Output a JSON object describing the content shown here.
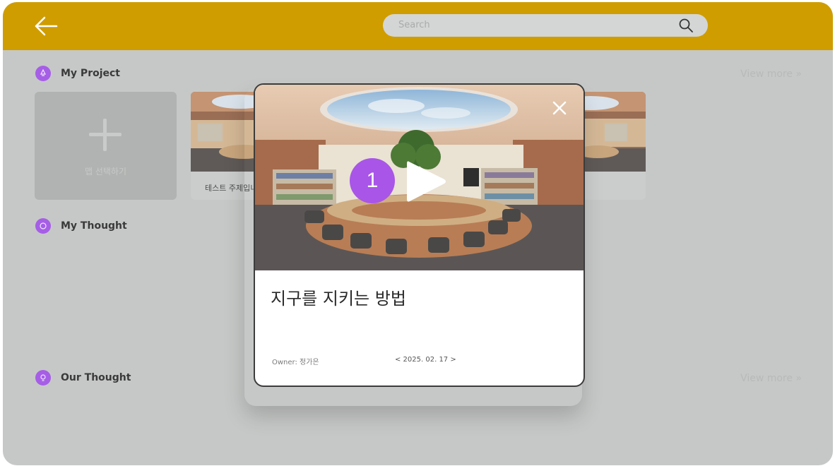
{
  "header": {
    "search_placeholder": "Search",
    "back_icon": "arrow-left-icon",
    "search_icon": "search-icon"
  },
  "sections": {
    "my_project": {
      "title": "My Project",
      "view_more": "View more »",
      "icon": "rocket-icon"
    },
    "my_thought": {
      "title": "My Thought",
      "icon": "brain-icon"
    },
    "our_thought": {
      "title": "Our Thought",
      "view_more": "View more »",
      "icon": "lightbulb-icon"
    }
  },
  "add_card": {
    "label": "맵 선택하기",
    "icon": "plus-icon"
  },
  "project_cards": [
    {
      "label": "테스트 주제입니"
    }
  ],
  "modal": {
    "title": "지구를 지키는 방법",
    "owner": "Owner: 정가은",
    "date": "< 2025. 02. 17 >",
    "badge": "1",
    "close_icon": "close-icon",
    "play_icon": "play-icon"
  },
  "colors": {
    "header": "#cf9d00",
    "accent": "#a855e8",
    "background": "#c6c8c7"
  }
}
